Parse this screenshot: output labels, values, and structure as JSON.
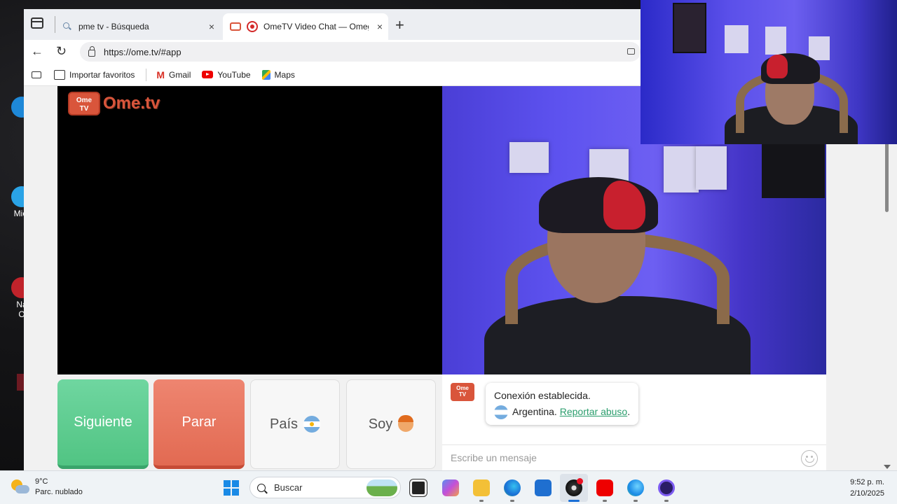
{
  "browser": {
    "tabs": [
      {
        "title": "pme tv - Búsqueda",
        "favicon": "search-icon"
      },
      {
        "title": "OmeTV Video Chat — Omegle",
        "favicon": "tv-icon",
        "recording": true
      }
    ],
    "close_glyph": "×",
    "new_tab_glyph": "+",
    "url": "https://ome.tv/#app",
    "back_glyph": "←",
    "reload_glyph": "↻",
    "bookmarks": [
      {
        "label": "Importar favoritos",
        "icon": "import-icon"
      },
      {
        "label": "Gmail",
        "icon": "gmail-icon"
      },
      {
        "label": "YouTube",
        "icon": "youtube-icon"
      },
      {
        "label": "Maps",
        "icon": "maps-icon"
      }
    ]
  },
  "app": {
    "logo_badge": "Ome\nTV",
    "logo_text": "Ome.tv",
    "buttons": {
      "next": "Siguiente",
      "stop": "Parar",
      "country": "País",
      "i_am": "Soy"
    },
    "chat": {
      "status": "Conexión establecida.",
      "country": "Argentina.",
      "report_link": "Reportar abuso",
      "report_suffix": ".",
      "placeholder": "Escribe un mensaje"
    },
    "colors": {
      "next": "#5fcd91",
      "stop": "#e8755e",
      "brand": "#d9553b",
      "link": "#2a9d6c"
    }
  },
  "desktop": {
    "icons": [
      {
        "label": "",
        "icon": "edge-shortcut-icon"
      },
      {
        "label": "Micr",
        "icon": "edge-shortcut-icon"
      },
      {
        "label": "Na\nO",
        "icon": "opera-shortcut-icon"
      }
    ]
  },
  "taskbar": {
    "weather_temp": "9°C",
    "weather_desc": "Parc. nublado",
    "search_label": "Buscar",
    "time": "9:52 p. m.",
    "date": "2/10/2025"
  }
}
